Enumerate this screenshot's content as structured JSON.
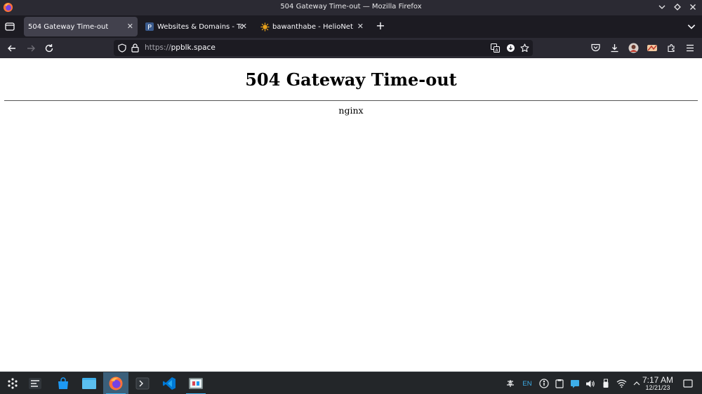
{
  "window": {
    "title": "504 Gateway Time-out — Mozilla Firefox"
  },
  "tabs": [
    {
      "label": "504 Gateway Time-out",
      "active": true
    },
    {
      "label": "Websites & Domains - Tom",
      "active": false
    },
    {
      "label": "bawanthabe - HelioNet",
      "active": false
    }
  ],
  "navbar": {
    "url_scheme": "https://",
    "url_host": "ppblk.space"
  },
  "page": {
    "heading": "504 Gateway Time-out",
    "server": "nginx"
  },
  "taskbar": {
    "language": "EN",
    "time": "7:17 AM",
    "date": "12/21/23"
  },
  "colors": {
    "accent": "#3daee9",
    "firefox_orange": "#ff7139"
  }
}
